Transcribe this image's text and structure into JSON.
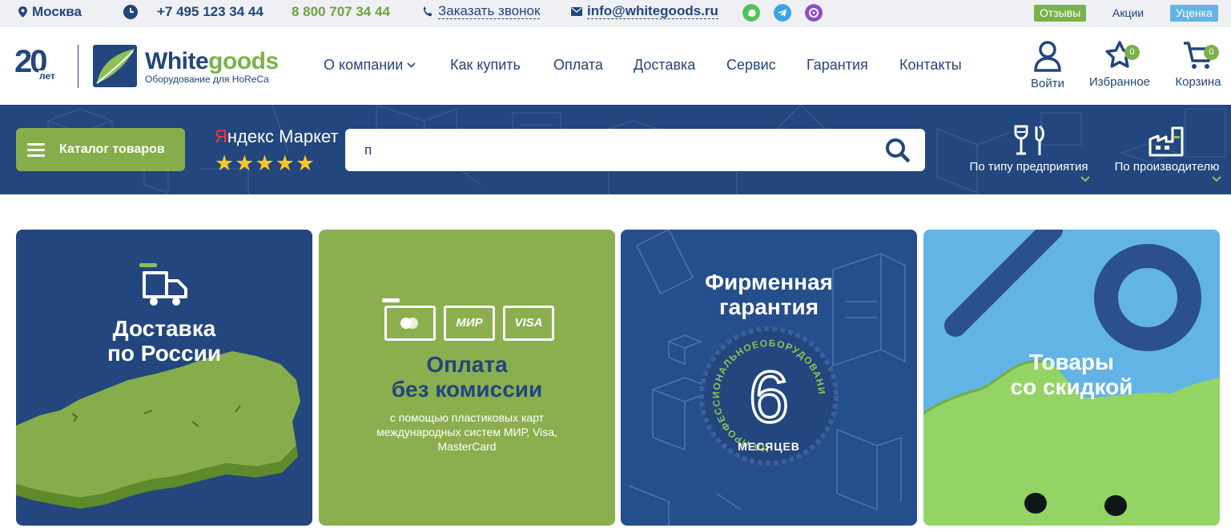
{
  "topbar": {
    "city": "Москва",
    "phone_main": "+7 495 123 34 44",
    "phone_free": "8 800 707 34 44",
    "callback": "Заказать звонок",
    "email": "info@whitegoods.ru",
    "reviews": "Отзывы",
    "promos": "Акции",
    "markdown": "Уценка"
  },
  "header": {
    "anniversary_number": "20",
    "anniversary_unit": "лет",
    "brand_white": "White",
    "brand_goods": "goods",
    "brand_tagline": "Оборудование для HoReCa",
    "nav": [
      "О компании",
      "Как купить",
      "Оплата",
      "Доставка",
      "Сервис",
      "Гарантия",
      "Контакты"
    ],
    "login": "Войти",
    "favorites": "Избранное",
    "favorites_count": "0",
    "cart": "Корзина",
    "cart_count": "0"
  },
  "band": {
    "catalog": "Каталог товаров",
    "market_y": "Я",
    "market_rest": "ндекс Маркет",
    "stars": "★★★★★",
    "search_value": "п",
    "filter_type": "По типу предприятия",
    "filter_maker": "По производителю"
  },
  "cards": [
    {
      "title1": "Доставка",
      "title2": "по России"
    },
    {
      "title1": "Оплата",
      "title2": "без комиссии",
      "sub1": "с помощью пластиковых карт",
      "sub2": "международных систем МИР, Visa,",
      "sub3": "MasterCard",
      "mir": "МИР",
      "visa": "VISA"
    },
    {
      "title1": "Фирменная",
      "title2": "гарантия",
      "number": "6",
      "months": "МЕСЯЦЕВ",
      "ring": "НА ПРОФЕССИОНАЛЬНОЕОБОРУДОВАНИЕ"
    },
    {
      "title1": "Товары",
      "title2": "со скидкой"
    }
  ],
  "colors": {
    "navy": "#22467d",
    "green": "#7bb14a",
    "card_green": "#8baf4f",
    "sky": "#63b4e6"
  }
}
